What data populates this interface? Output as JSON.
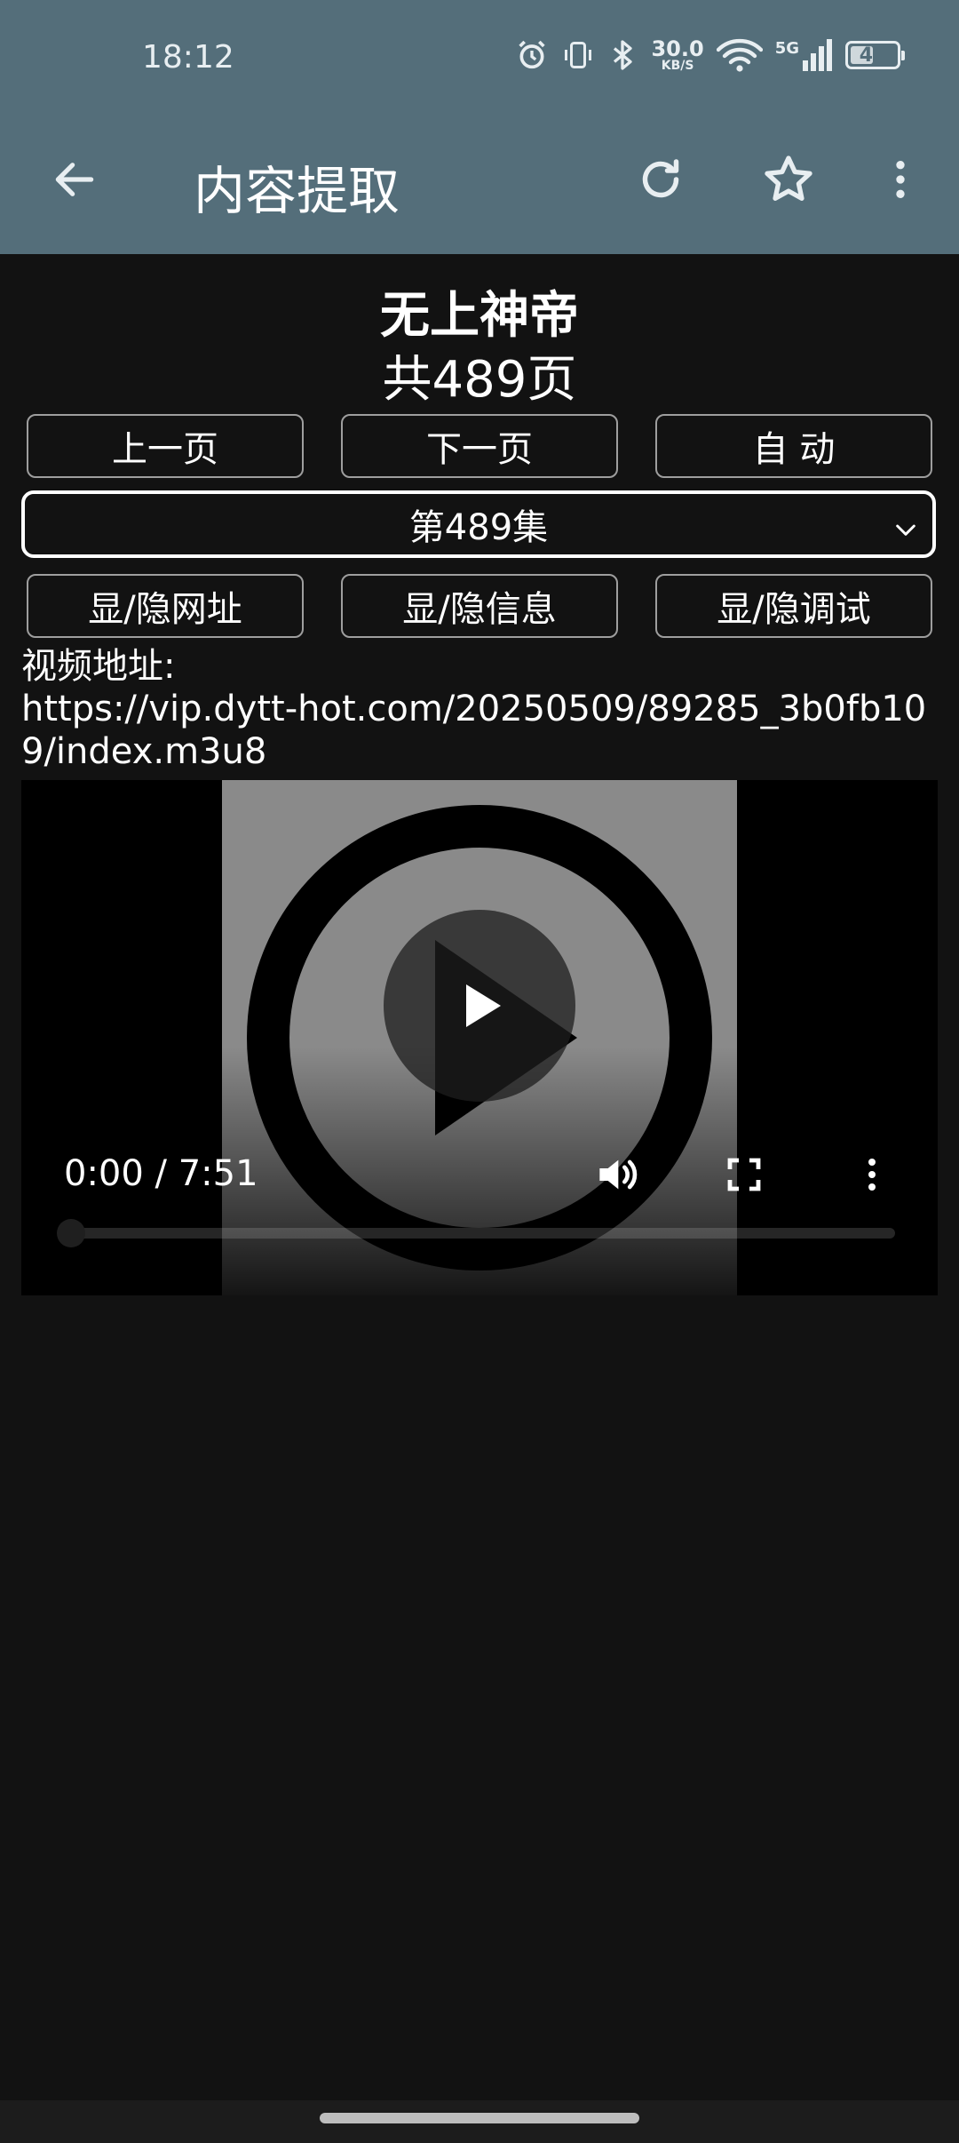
{
  "status_bar": {
    "time": "18:12",
    "net_speed_value": "30.0",
    "net_speed_unit": "KB/S",
    "network_type": "5G",
    "battery_level": "44"
  },
  "toolbar": {
    "title": "内容提取"
  },
  "content": {
    "book_title": "无上神帝",
    "page_count": "共489页",
    "buttons_row1": [
      "上一页",
      "下一页",
      "自 动"
    ],
    "episode_select": "第489集",
    "buttons_row2": [
      "显/隐网址",
      "显/隐信息",
      "显/隐调试"
    ],
    "url_label": "视频地址:",
    "url_value": " https://vip.dytt-hot.com/20250509/89285_3b0fb109/index.m3u8"
  },
  "video": {
    "time_display": "0:00 / 7:51",
    "progress": 0
  },
  "colors": {
    "app_bar": "#546e7a",
    "background": "#121212"
  }
}
